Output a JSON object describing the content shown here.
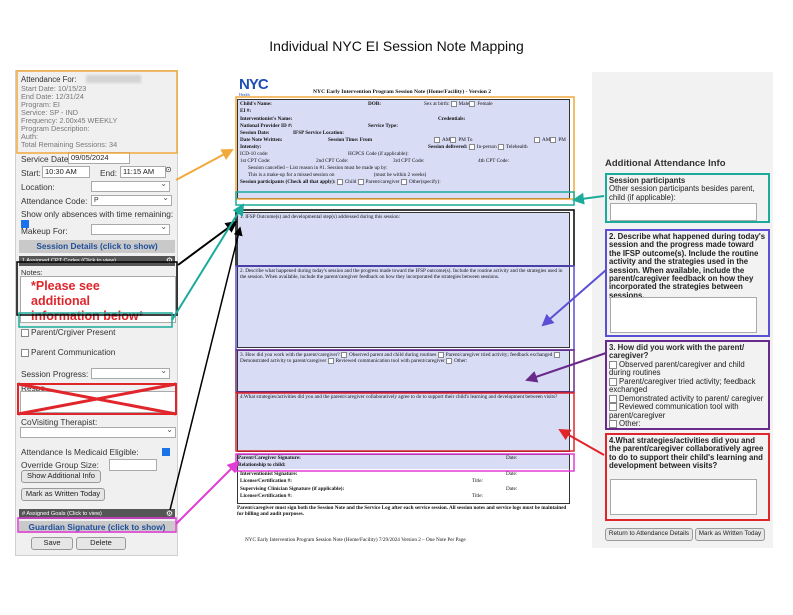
{
  "page_title": "Individual NYC EI Session Note Mapping",
  "left": {
    "attendance_for_label": "Attendance For:",
    "start_date": "Start Date: 10/15/23",
    "end_date": "End Date: 12/31/24",
    "program": "Program: EI",
    "service": "Service: SP - IND",
    "frequency": "Frequency: 2.00x45 WEEKLY",
    "program_description": "Program Description:",
    "auth": "Auth:",
    "total_remaining": "Total Remaining Sessions: 34",
    "service_date_label": "Service Date:",
    "service_date_value": "09/05/2024",
    "start_label": "Start:",
    "start_value": "10:30 AM",
    "end_label": "End:",
    "end_value": "11:15 AM",
    "location_label": "Location:",
    "attendance_code_label": "Attendance Code:",
    "attendance_code_value": "P",
    "show_only_absences": "Show only absences with time remaining:",
    "makeup_for_label": "Makeup For:",
    "session_details_btn": "Session Details (click to show)",
    "assigned_cpt_bar": "1 Assigned CPT Codes (Click to view)",
    "notes_label": "Notes:",
    "notes_text": "*Please see additional information below*",
    "parent_present": "Parent/Crgiver Present",
    "parent_communication": "Parent Communication",
    "session_progress_label": "Session Progress:",
    "response_label": "Respo",
    "covisiting_label": "CoVisiting Therapist:",
    "medicaid_label": "Attendance Is Medicaid Eligible:",
    "override_group_label": "Override Group Size:",
    "show_additional_btn": "Show Additional Info",
    "mark_written_btn": "Mark as Written Today",
    "assigned_goals_bar": "# Assigned Goals (Click to view)",
    "guardian_sig_btn": "Guardian Signature (click to show)",
    "save_btn": "Save",
    "delete_btn": "Delete"
  },
  "form": {
    "logo_text": "NYC",
    "logo_sub": "Health",
    "title": "NYC Early Intervention Program Session Note (Home/Facility) - Version 2",
    "childs_name": "Child's Name:",
    "dob": "DOB:",
    "sex_at_birth": "Sex at birth:",
    "male": "Male",
    "female": "Female",
    "ei_num": "EI #:",
    "interventionist_name": "Interventionist's Name:",
    "credentials": "Credentials:",
    "npi": "National Provider ID #:",
    "service_type": "Service Type:",
    "session_date": "Session Date:",
    "ifsp_location": "IFSP Service Location:",
    "date_note_written": "Date Note Written:",
    "session_time": "Session Time: From",
    "am": "AM",
    "pm_to": "PM To",
    "pm": "PM",
    "intensity": "Intensity:",
    "session_delivered": "Session delivered:",
    "in_person": "In-person",
    "telehealth": "Telehealth",
    "icd10": "ICD-10 code:",
    "hcpcs": "HCPCS Code (if applicable):",
    "cpt1": "1st CPT Code:",
    "cpt2": "2nd CPT Code:",
    "cpt3": "3rd CPT Code:",
    "cpt4": "4th CPT Code:",
    "cancelled": "Session cancelled – List reason in #1. Session must be made up by:",
    "makeup_line": "This is a make-up for a missed session on",
    "within_2_weeks": "(must be within 2 weeks)",
    "participants_line": "Session participants (Check all that apply):",
    "child": "Child",
    "parent_caregiver": "Parent/caregiver",
    "other_specify": "Other(specify):",
    "q1": "1. IFSP Outcome(s) and developmental step(s) addressed during this session:",
    "q2": "2. Describe what happened during today's session and the progress made toward the IFSP outcome(s). Include the routine activity and the strategies used in the session. When available, include the parent/caregiver feedback on how they incorporated the strategies between sessions.",
    "q3_a": "3. How did you work with the parent/caregiver?",
    "q3_opt1": "Observed parent and child during routines",
    "q3_opt2": "Parent/caregiver tried activity; feedback exchanged",
    "q3_opt3": "Demonstrated activity to parent/caregiver",
    "q3_opt4": "Reviewed communication tool with parent/caregiver",
    "q3_opt5": "Other:",
    "q4": "4.What strategies/activities did you and the parent/caregiver collaboratively agree to do to support their child's learning and development between visits?",
    "parent_sig": "Parent/Caregiver Signature:",
    "relationship": "Relationship to child:",
    "date": "Date:",
    "interventionist_sig": "Interventionist Signature:",
    "license": "License/Certification #:",
    "title_label": "Title:",
    "supervising_sig": "Supervising Clinician Signature (if applicable):",
    "footer_note": "Parent/caregiver must sign both the Session Note and the Service Log after each service session. All session notes and service logs must be maintained for billing and audit purposes.",
    "footer_version": "NYC Early Intervention Program Session Note (Home/Facility) 7/29/2024 Version 2 – One Note Per Page"
  },
  "right": {
    "heading": "Additional Attendance Info",
    "participants_title": "Session participants",
    "participants_desc": "Other session participants besides parent, child (if applicable):",
    "q2": "2. Describe what happened during today's session and the progress made toward the IFSP outcome(s). Include the routine activity and the strategies used in the session. When available, include the parent/caregiver feedback on how they incorporated the strategies between sessions.",
    "q3": "3. How did you work with the parent/ caregiver?",
    "q3_opts": [
      "Observed parent/caregiver and child during routines",
      "Parent/caregiver tried activity; feedback exchanged",
      "Demonstrated activity to parent/ caregiver",
      "Reviewed communication tool with parent/caregiver",
      "Other:"
    ],
    "q4": "4.What strategies/activities did you and the parent/caregiver collaboratively agree to do to support their child's learning and development between visits?",
    "return_btn": "Return to Attendance Details",
    "mark_written_btn": "Mark as Written Today"
  },
  "colors": {
    "orange": "#f2a93b",
    "teal": "#1aab9b",
    "black": "#000000",
    "purple_blue": "#5b4fd6",
    "purple": "#6a2a8c",
    "red": "#e0252b",
    "magenta": "#e23bd6",
    "form_fill": "#d8dcf5"
  }
}
